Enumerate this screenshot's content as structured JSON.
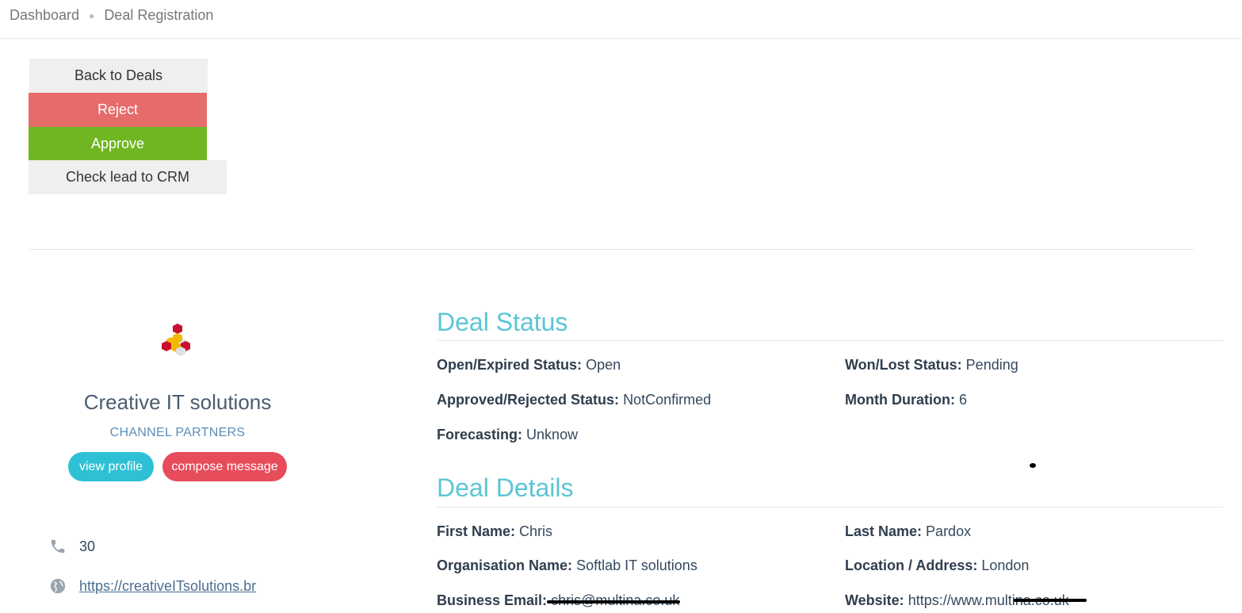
{
  "breadcrumb": {
    "home": "Dashboard",
    "current": "Deal Registration"
  },
  "actions": {
    "back": "Back to Deals",
    "reject": "Reject",
    "approve": "Approve",
    "crm": "Check lead to CRM"
  },
  "profile": {
    "name": "Creative IT solutions",
    "type": "CHANNEL PARTNERS",
    "view_profile": "view profile",
    "compose_message": "compose message",
    "phone": "30",
    "website": "https://creativeITsolutions.br",
    "icons": {
      "phone": "phone-icon",
      "globe": "globe-icon",
      "logo": "cube-logo"
    }
  },
  "deal_status": {
    "title": "Deal Status",
    "open_expired": {
      "label": "Open/Expired Status:",
      "value": "Open"
    },
    "won_lost": {
      "label": "Won/Lost Status:",
      "value": "Pending"
    },
    "approved_rejected": {
      "label": "Approved/Rejected Status:",
      "value": "NotConfirmed"
    },
    "month_duration": {
      "label": "Month Duration:",
      "value": "6"
    },
    "forecasting": {
      "label": "Forecasting:",
      "value": "Unknow"
    }
  },
  "deal_details": {
    "title": "Deal Details",
    "first_name": {
      "label": "First Name:",
      "value": "Chris"
    },
    "last_name": {
      "label": "Last Name:",
      "value": "Pardox"
    },
    "organisation": {
      "label": "Organisation Name:",
      "value": "Softlab IT solutions"
    },
    "location": {
      "label": "Location / Address:",
      "value": "London"
    },
    "email": {
      "label": "Business Email:",
      "value": "chris@multina.co.uk"
    },
    "website": {
      "label": "Website:",
      "value": "https://www.multina.co.uk"
    }
  },
  "colors": {
    "accent": "#5bc5d5",
    "reject": "#e66b6b",
    "approve": "#6fb622",
    "view_profile": "#2ec0d4",
    "compose_message": "#e74c5b"
  }
}
